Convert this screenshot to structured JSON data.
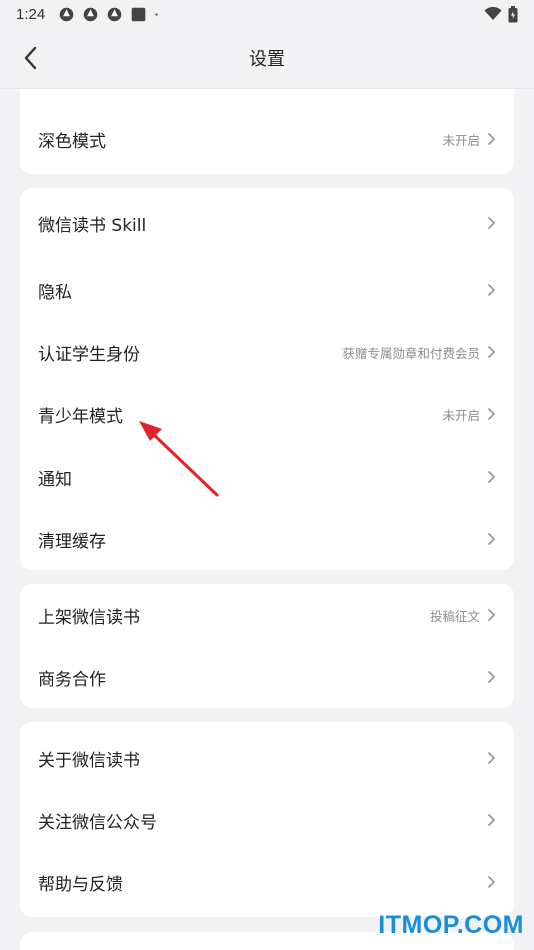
{
  "status_bar": {
    "time": "1:24",
    "notification_icons": [
      "app-badge-icon",
      "app-badge-icon",
      "app-badge-icon",
      "square-icon",
      "dot-icon"
    ],
    "right_icons": [
      "wifi-icon",
      "battery-icon"
    ]
  },
  "header": {
    "title": "设置",
    "back_icon": "back-arrow-icon"
  },
  "sections": [
    {
      "rows": [
        {
          "label": "深色模式",
          "hint": "未开启"
        }
      ]
    },
    {
      "rows": [
        {
          "label": "微信读书 Skill",
          "hint": ""
        },
        {
          "label": "隐私",
          "hint": ""
        },
        {
          "label": "认证学生身份",
          "hint": "获赠专属勋章和付费会员"
        },
        {
          "label": "青少年模式",
          "hint": "未开启"
        },
        {
          "label": "通知",
          "hint": ""
        },
        {
          "label": "清理缓存",
          "hint": ""
        }
      ]
    },
    {
      "rows": [
        {
          "label": "上架微信读书",
          "hint": "投稿征文"
        },
        {
          "label": "商务合作",
          "hint": ""
        }
      ]
    },
    {
      "rows": [
        {
          "label": "关于微信读书",
          "hint": ""
        },
        {
          "label": "关注微信公众号",
          "hint": ""
        },
        {
          "label": "帮助与反馈",
          "hint": ""
        }
      ]
    }
  ],
  "annotation": {
    "arrow_color": "#e0242a"
  },
  "watermark": {
    "text": "ITMOP.COM",
    "color": "#1a8fd6"
  }
}
